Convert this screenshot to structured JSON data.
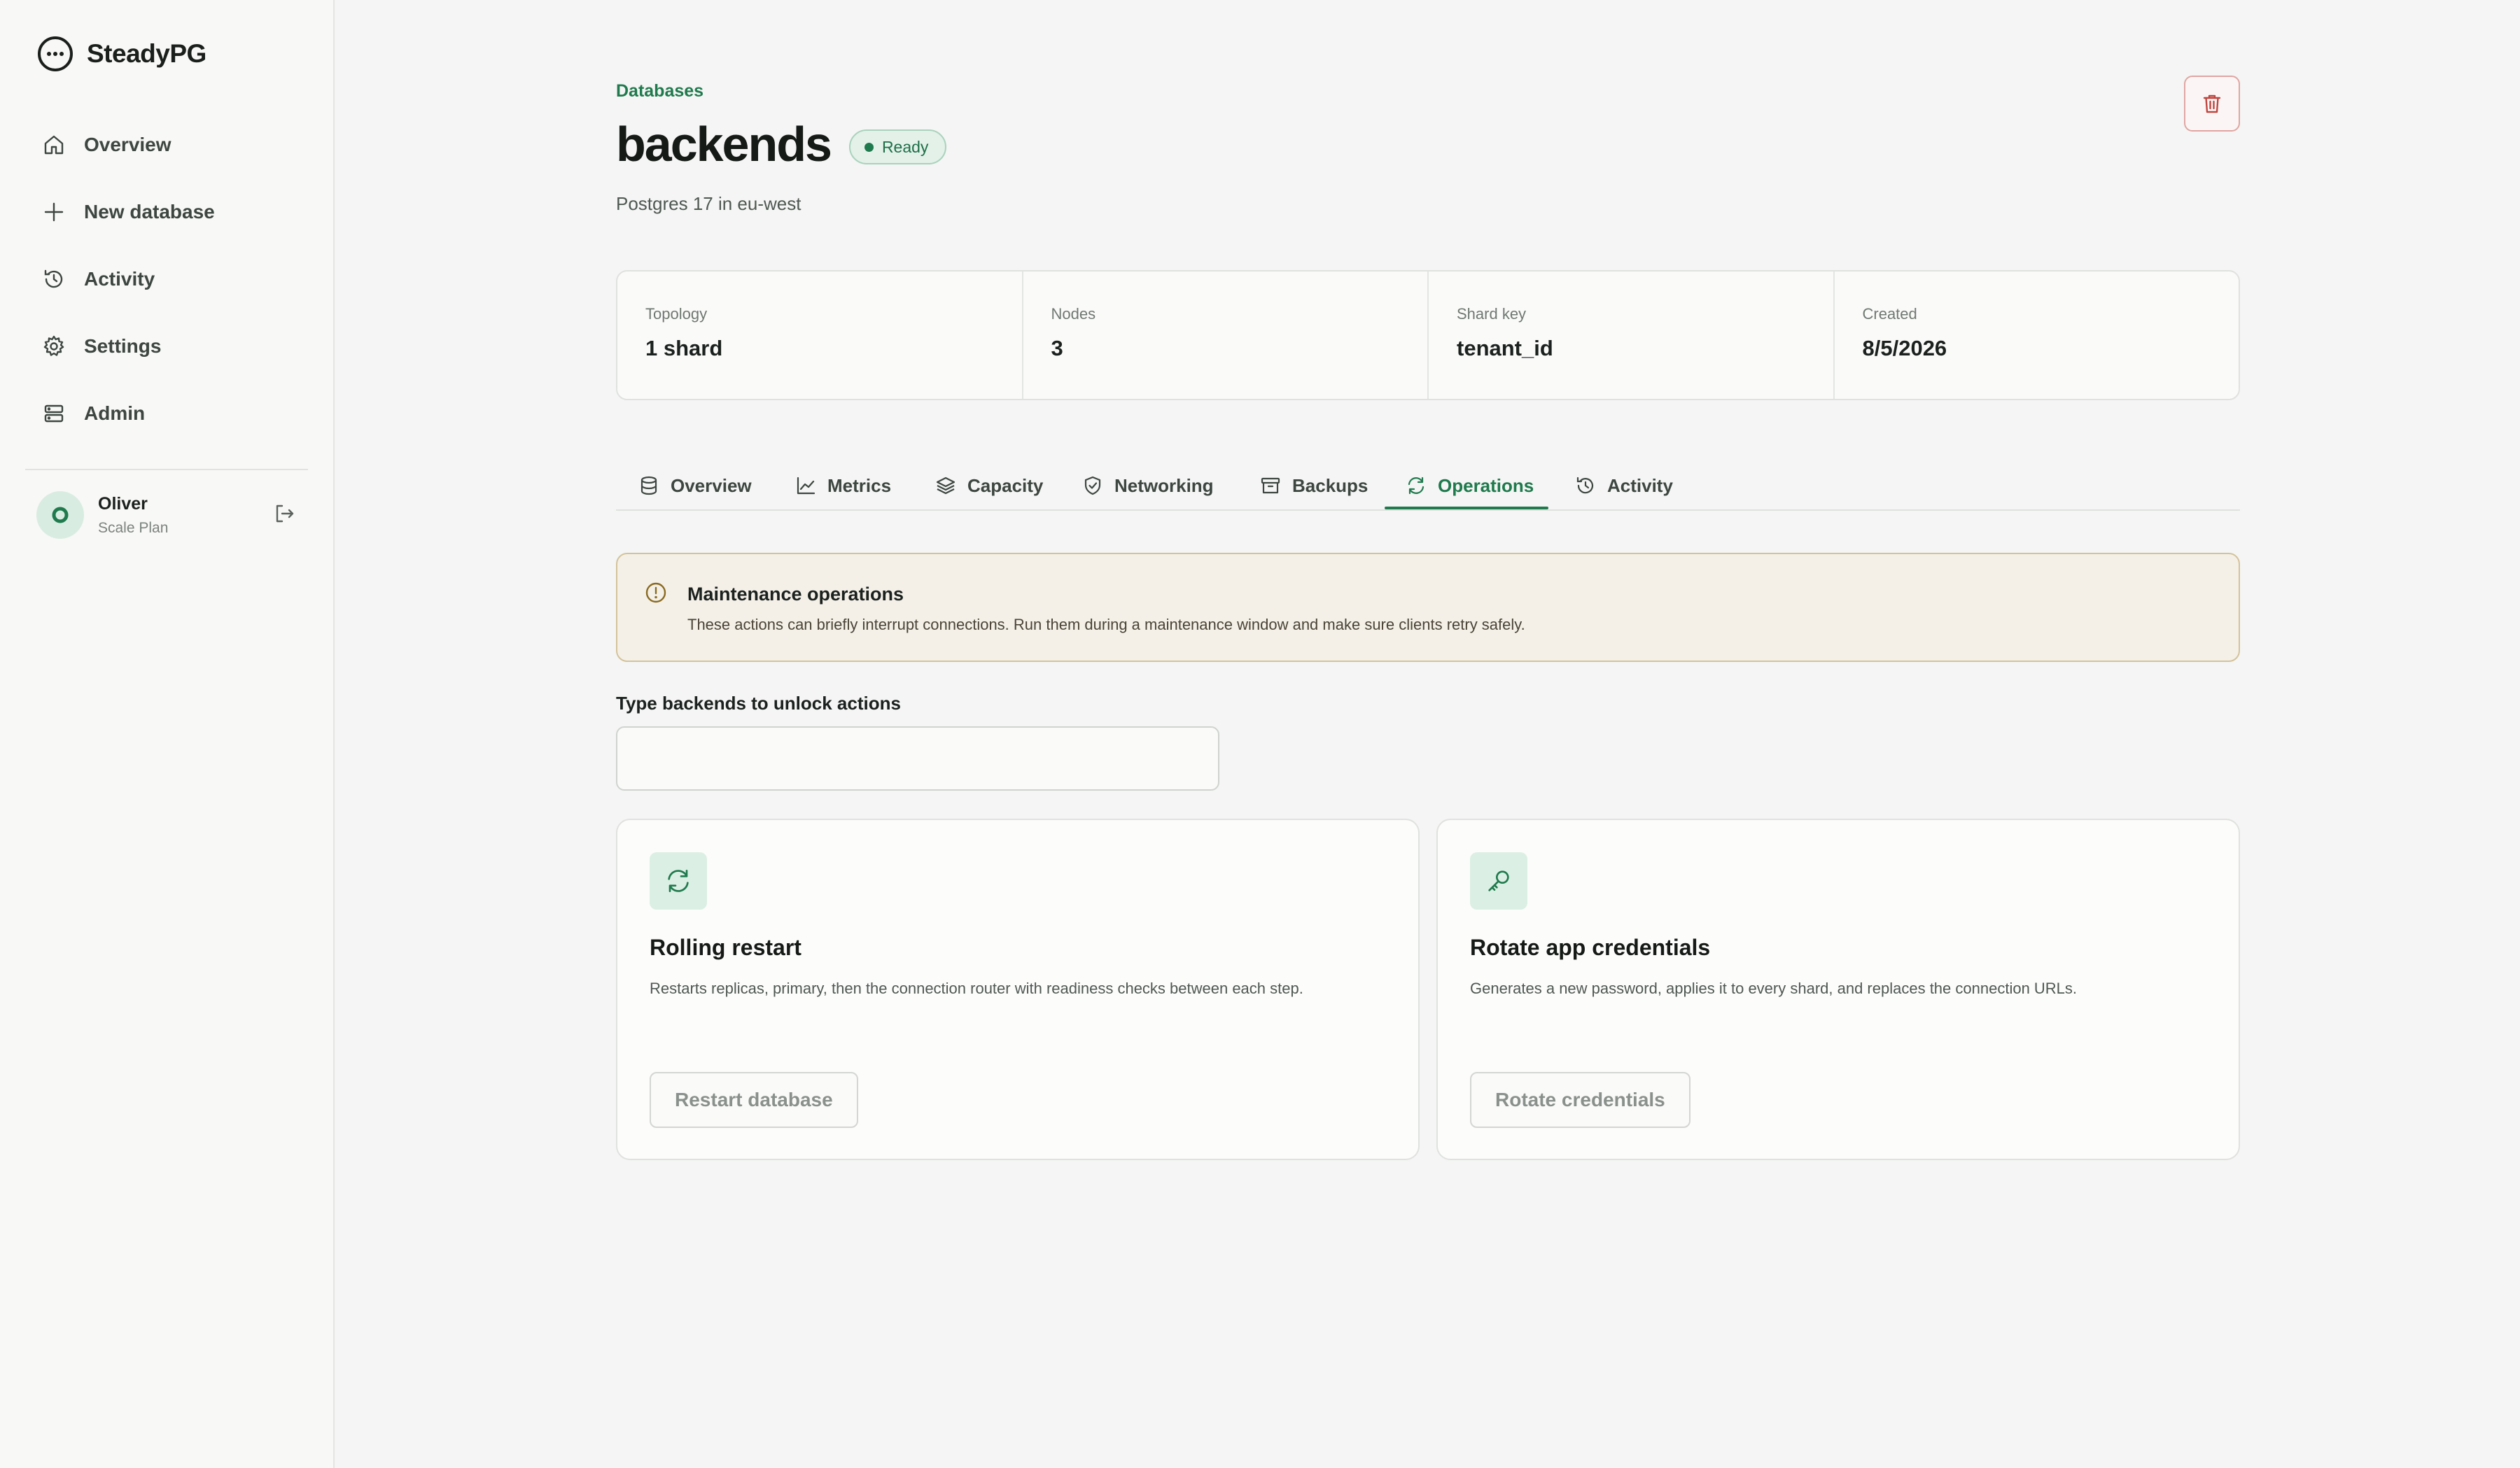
{
  "app": {
    "name": "SteadyPG"
  },
  "sidebar": {
    "items": [
      {
        "label": "Overview",
        "icon": "home-icon"
      },
      {
        "label": "New database",
        "icon": "plus-icon"
      },
      {
        "label": "Activity",
        "icon": "history-icon"
      },
      {
        "label": "Settings",
        "icon": "gear-icon"
      },
      {
        "label": "Admin",
        "icon": "server-icon"
      }
    ],
    "user": {
      "name": "Oliver",
      "plan": "Scale Plan"
    }
  },
  "header": {
    "breadcrumb": "Databases",
    "title": "backends",
    "status": "Ready",
    "subtitle": "Postgres 17 in eu-west"
  },
  "stats": [
    {
      "label": "Topology",
      "value": "1 shard"
    },
    {
      "label": "Nodes",
      "value": "3"
    },
    {
      "label": "Shard key",
      "value": "tenant_id"
    },
    {
      "label": "Created",
      "value": "8/5/2026"
    }
  ],
  "tabs": [
    {
      "label": "Overview",
      "icon": "database-icon"
    },
    {
      "label": "Metrics",
      "icon": "chart-line-icon"
    },
    {
      "label": "Capacity",
      "icon": "layers-icon"
    },
    {
      "label": "Networking",
      "icon": "shield-icon"
    },
    {
      "label": "Backups",
      "icon": "archive-icon"
    },
    {
      "label": "Operations",
      "icon": "refresh-icon",
      "active": true
    },
    {
      "label": "Activity",
      "icon": "history-icon"
    }
  ],
  "alert": {
    "title": "Maintenance operations",
    "text": "These actions can briefly interrupt connections. Run them during a maintenance window and make sure clients retry safely."
  },
  "unlock": {
    "label": "Type backends to unlock actions",
    "value": "",
    "placeholder": ""
  },
  "cards": [
    {
      "title": "Rolling restart",
      "description": "Restarts replicas, primary, then the connection router with readiness checks between each step.",
      "button": "Restart database",
      "icon": "refresh-icon"
    },
    {
      "title": "Rotate app credentials",
      "description": "Generates a new password, applies it to every shard, and replaces the connection URLs.",
      "button": "Rotate credentials",
      "icon": "key-icon"
    }
  ],
  "colors": {
    "accent": "#1f7a4d",
    "danger": "#c0453f",
    "warning_border": "#d4c29a",
    "warning_bg": "#f4f0e8"
  }
}
